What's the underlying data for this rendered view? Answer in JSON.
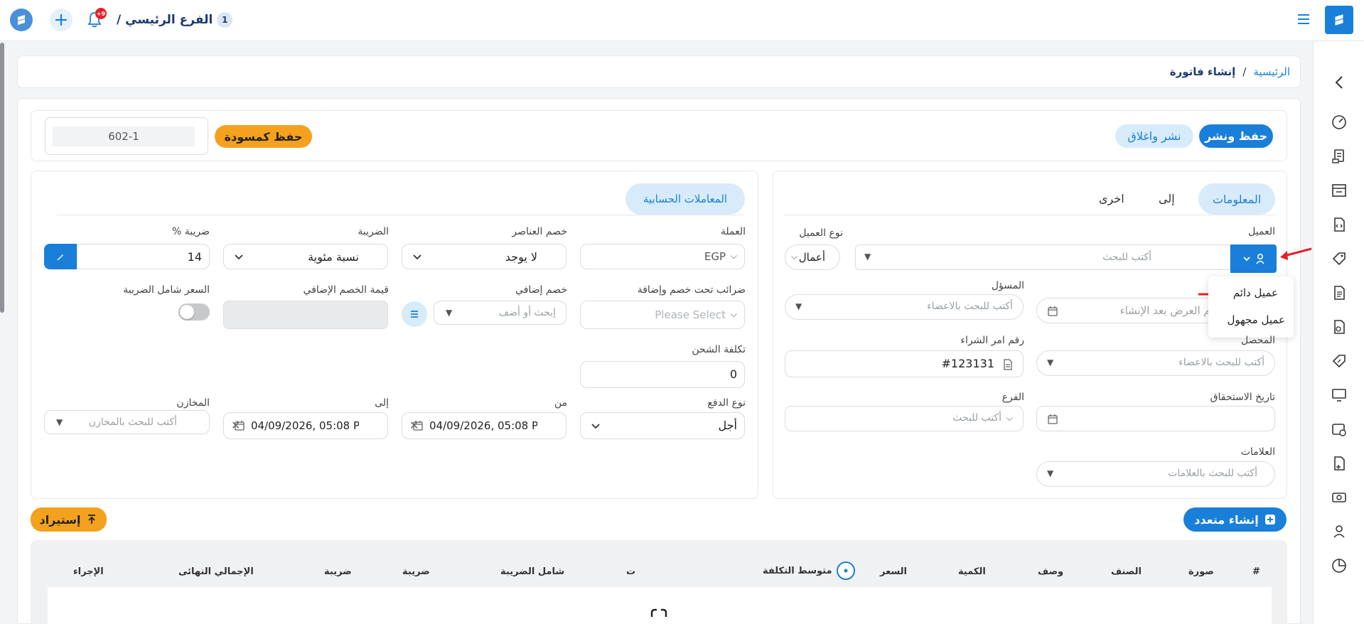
{
  "header": {
    "branch_name": "الفرع الرئيسي /",
    "branch_number": "1",
    "notification_badge": "+9"
  },
  "breadcrumb": {
    "home": "الرئيسية",
    "separator": "/",
    "current": "إنشاء فاتورة"
  },
  "toolbar": {
    "save_publish": "حفظ ونشر",
    "publish_close": "نشر واغلاق",
    "save_draft": "حفظ كمسودة",
    "invoice_number": "602-1"
  },
  "info_tabs": {
    "info": "المعلومات",
    "to": "إلى",
    "other": "اخرى"
  },
  "client_form": {
    "client_label": "العميل",
    "client_placeholder": "أكتب للبحث",
    "client_type_label": "نوع العميل",
    "client_type_value": "أعمال",
    "menu_permanent": "عميل دائم",
    "menu_unknown": "عميل مجهول",
    "date_placeholder": "سيتم العرض بعد الإنشاء",
    "responsible_label": "المسؤل",
    "responsible_placeholder": "أكتب للبحث بالاعضاء",
    "collector_label": "المحصل",
    "collector_placeholder": "أكتب للبحث بالاعضاء",
    "po_label": "رقم امر الشراء",
    "po_value": "#123131",
    "due_label": "تاريخ الاستحقاق",
    "branch_label": "الفرع",
    "branch_placeholder": "أكتب للبحث",
    "tags_label": "العلامات",
    "tags_placeholder": "أكتب للبحث بالعلامات"
  },
  "accounting": {
    "tab": "المعاملات الحسابية",
    "currency_label": "العملة",
    "currency_value": "EGP",
    "items_discount_label": "خصم العناصر",
    "items_discount_value": "لا يوجد",
    "tax_label": "الضريبة",
    "tax_value": "نسبة مئوية",
    "tax_pct_label": "ضريبة %",
    "tax_pct_value": "14",
    "sub_tax_label": "ضرائب تحت خصم وإضافة",
    "sub_tax_placeholder": "Please Select",
    "extra_discount_label": "خصم إضافي",
    "extra_discount_placeholder": "إبحث أو أضف",
    "extra_discount_value_label": "قيمة الخصم الإضافي",
    "price_incl_tax_label": "السعر شامل الضريبة",
    "shipping_label": "تكلفة الشحن",
    "shipping_value": "0",
    "payment_type_label": "نوع الدفع",
    "payment_type_value": "أجل",
    "from_label": "من",
    "from_value": "04/09/2026, 05:08 P",
    "to_label": "إلى",
    "to_value": "04/09/2026, 05:08 P",
    "warehouses_label": "المخازن",
    "warehouses_placeholder": "أكتب للبحث بالمخازن"
  },
  "actions": {
    "create_multiple": "إنشاء متعدد",
    "import": "إستيراد"
  },
  "table": {
    "headers": [
      "#",
      "صورة",
      "الصنف",
      "وصف",
      "الكمية",
      "السعر",
      "متوسط التكلفة",
      "ت",
      "شامل الضريبة",
      "ضريبة",
      "ضريبة",
      "الإجمالي النهائى",
      "الإجراء"
    ]
  },
  "colors": {
    "primary": "#1a7fd9",
    "accent": "#f3a11f",
    "annotation": "#e5202a"
  }
}
